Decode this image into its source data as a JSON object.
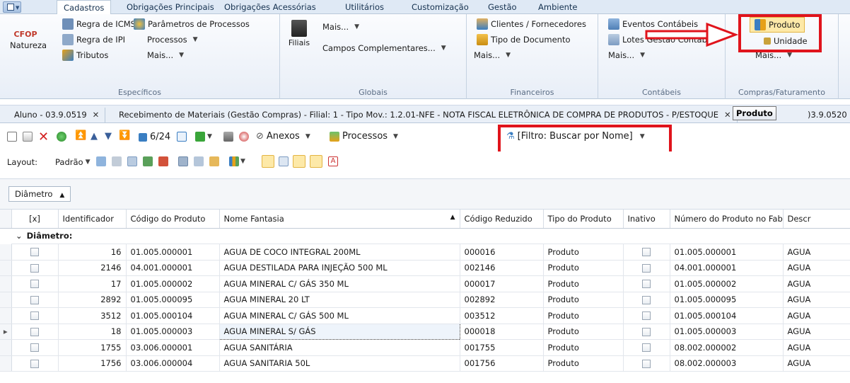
{
  "ribbon_tabs": [
    "Cadastros",
    "Obrigações Principais",
    "Obrigações Acessórias",
    "Utilitários",
    "Customização",
    "Gestão",
    "Ambiente"
  ],
  "ribbon": {
    "especificos": {
      "label": "Específicos",
      "natureza": "Natureza",
      "cfop": "CFOP",
      "regra_icms": "Regra de ICMS",
      "regra_ipi": "Regra de IPI",
      "tributos": "Tributos",
      "parametros": "Parâmetros de Processos",
      "processos": "Processos",
      "mais": "Mais..."
    },
    "globais": {
      "label": "Globais",
      "filiais": "Filiais",
      "mais": "Mais...",
      "campos": "Campos Complementares..."
    },
    "financeiros": {
      "label": "Financeiros",
      "clientes": "Clientes / Fornecedores",
      "tipo_doc": "Tipo de Documento",
      "mais": "Mais..."
    },
    "contabeis": {
      "label": "Contábeis",
      "eventos": "Eventos Contábeis",
      "lotes": "Lotes Gestão Contábil",
      "mais": "Mais..."
    },
    "compras": {
      "label": "Compras/Faturamento",
      "produto": "Produto",
      "unidade": "Unidade",
      "mais": "Mais..."
    }
  },
  "doc_tabs": {
    "tab1": "Aluno - 03.9.0519",
    "tab2": "Recebimento de Materiais (Gestão Compras) - Filial: 1 - Tipo Mov.: 1.2.01-NFE - NOTA FISCAL ELETRÔNICA DE COMPRA DE PRODUTOS - P/ESTOQUE",
    "tab3_suffix": ")3.9.0520",
    "tooltip": "Produto"
  },
  "toolbar": {
    "record_counter": "6/24",
    "anexos": "Anexos",
    "processos": "Processos",
    "filtro": "[Filtro: Buscar por Nome]",
    "layout_label": "Layout:",
    "padrao": "Padrão"
  },
  "group_panel": {
    "label": "Diâmetro",
    "group_row": "Diâmetro:"
  },
  "grid": {
    "columns": [
      "[x]",
      "Identificador",
      "Código do Produto",
      "Nome Fantasia",
      "Código Reduzido",
      "Tipo do Produto",
      "Inativo",
      "Número do Produto no Fabricante",
      "Descr"
    ],
    "rows": [
      {
        "id": "16",
        "codigo": "01.005.000001",
        "nome": "AGUA DE COCO INTEGRAL 200ML",
        "reduzido": "000016",
        "tipo": "Produto",
        "fabricante": "01.005.000001",
        "descr": "AGUA"
      },
      {
        "id": "2146",
        "codigo": "04.001.000001",
        "nome": "AGUA DESTILADA PARA INJEÇÃO 500 ML",
        "reduzido": "002146",
        "tipo": "Produto",
        "fabricante": "04.001.000001",
        "descr": "AGUA"
      },
      {
        "id": "17",
        "codigo": "01.005.000002",
        "nome": "AGUA MINERAL  C/ GÁS 350 ML",
        "reduzido": "000017",
        "tipo": "Produto",
        "fabricante": "01.005.000002",
        "descr": "AGUA"
      },
      {
        "id": "2892",
        "codigo": "01.005.000095",
        "nome": "AGUA MINERAL 20 LT",
        "reduzido": "002892",
        "tipo": "Produto",
        "fabricante": "01.005.000095",
        "descr": "AGUA"
      },
      {
        "id": "3512",
        "codigo": "01.005.000104",
        "nome": "AGUA MINERAL C/ GÁS 500 ML",
        "reduzido": "003512",
        "tipo": "Produto",
        "fabricante": "01.005.000104",
        "descr": "AGUA"
      },
      {
        "id": "18",
        "codigo": "01.005.000003",
        "nome": "AGUA MINERAL S/ GÁS",
        "reduzido": "000018",
        "tipo": "Produto",
        "fabricante": "01.005.000003",
        "descr": "AGUA"
      },
      {
        "id": "1755",
        "codigo": "03.006.000001",
        "nome": "AGUA SANITÁRIA",
        "reduzido": "001755",
        "tipo": "Produto",
        "fabricante": "08.002.000002",
        "descr": "AGUA"
      },
      {
        "id": "1756",
        "codigo": "03.006.000004",
        "nome": "AGUA SANITARIA 50L",
        "reduzido": "001756",
        "tipo": "Produto",
        "fabricante": "08.002.000003",
        "descr": "AGUA"
      }
    ]
  },
  "colors": {
    "accent": "#e0141c",
    "ribbon_bg": "#e8eef7",
    "selection": "#fdf0b6"
  }
}
